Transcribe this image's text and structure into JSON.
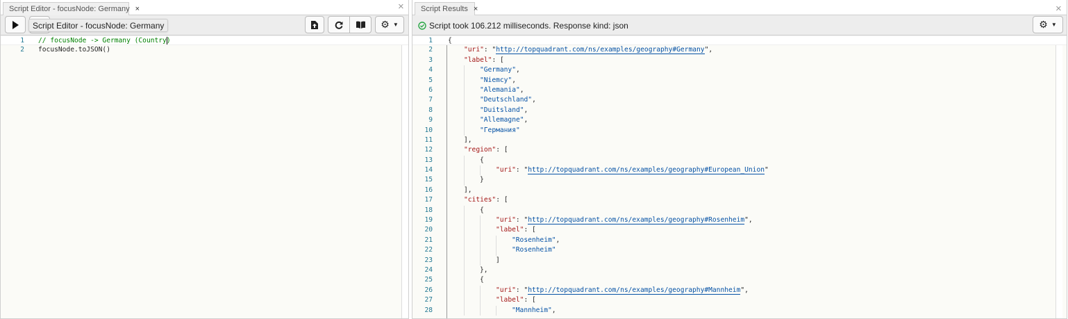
{
  "left": {
    "tab_label": "Script Editor - focusNode: Germany",
    "tab_close": "×",
    "panel_close": "×",
    "tooltip": "Script Editor - focusNode: Germany",
    "toolbar": {
      "run_icon": "play-icon",
      "export_icon": "file-export-icon",
      "refresh_icon": "refresh-icon",
      "docs_icon": "book-icon",
      "settings_icon": "gear-icon"
    },
    "lines": [
      {
        "n": "1",
        "parts": [
          {
            "t": "// focusNode -> Germany (Country)",
            "k": "c"
          }
        ]
      },
      {
        "n": "2",
        "parts": [
          {
            "t": "focusNode.toJSON()",
            "k": "p"
          }
        ]
      }
    ]
  },
  "right": {
    "tab_label": "Script Results",
    "tab_close": "×",
    "panel_close": "×",
    "status": "Script took 106.212 milliseconds. Response kind: json",
    "status_icon": "check-circle-icon",
    "colors": {
      "success": "#28a745",
      "key": "#a31515",
      "string": "#0451a5",
      "line_number": "#237893"
    },
    "lines": [
      {
        "n": "1",
        "i": 0,
        "parts": [
          {
            "t": "{",
            "k": "p"
          }
        ]
      },
      {
        "n": "2",
        "i": 1,
        "parts": [
          {
            "t": "\"uri\"",
            "k": "k"
          },
          {
            "t": ": \"",
            "k": "p"
          },
          {
            "t": "http://topquadrant.com/ns/examples/geography#Germany",
            "k": "link"
          },
          {
            "t": "\",",
            "k": "p"
          }
        ]
      },
      {
        "n": "3",
        "i": 1,
        "parts": [
          {
            "t": "\"label\"",
            "k": "k"
          },
          {
            "t": ": [",
            "k": "p"
          }
        ]
      },
      {
        "n": "4",
        "i": 2,
        "parts": [
          {
            "t": "\"Germany\"",
            "k": "s"
          },
          {
            "t": ",",
            "k": "p"
          }
        ]
      },
      {
        "n": "5",
        "i": 2,
        "parts": [
          {
            "t": "\"Niemcy\"",
            "k": "s"
          },
          {
            "t": ",",
            "k": "p"
          }
        ]
      },
      {
        "n": "6",
        "i": 2,
        "parts": [
          {
            "t": "\"Alemania\"",
            "k": "s"
          },
          {
            "t": ",",
            "k": "p"
          }
        ]
      },
      {
        "n": "7",
        "i": 2,
        "parts": [
          {
            "t": "\"Deutschland\"",
            "k": "s"
          },
          {
            "t": ",",
            "k": "p"
          }
        ]
      },
      {
        "n": "8",
        "i": 2,
        "parts": [
          {
            "t": "\"Duitsland\"",
            "k": "s"
          },
          {
            "t": ",",
            "k": "p"
          }
        ]
      },
      {
        "n": "9",
        "i": 2,
        "parts": [
          {
            "t": "\"Allemagne\"",
            "k": "s"
          },
          {
            "t": ",",
            "k": "p"
          }
        ]
      },
      {
        "n": "10",
        "i": 2,
        "parts": [
          {
            "t": "\"Германия\"",
            "k": "s"
          }
        ]
      },
      {
        "n": "11",
        "i": 1,
        "parts": [
          {
            "t": "],",
            "k": "p"
          }
        ]
      },
      {
        "n": "12",
        "i": 1,
        "parts": [
          {
            "t": "\"region\"",
            "k": "k"
          },
          {
            "t": ": [",
            "k": "p"
          }
        ]
      },
      {
        "n": "13",
        "i": 2,
        "parts": [
          {
            "t": "{",
            "k": "p"
          }
        ]
      },
      {
        "n": "14",
        "i": 3,
        "parts": [
          {
            "t": "\"uri\"",
            "k": "k"
          },
          {
            "t": ": \"",
            "k": "p"
          },
          {
            "t": "http://topquadrant.com/ns/examples/geography#European_Union",
            "k": "link"
          },
          {
            "t": "\"",
            "k": "p"
          }
        ]
      },
      {
        "n": "15",
        "i": 2,
        "parts": [
          {
            "t": "}",
            "k": "p"
          }
        ]
      },
      {
        "n": "16",
        "i": 1,
        "parts": [
          {
            "t": "],",
            "k": "p"
          }
        ]
      },
      {
        "n": "17",
        "i": 1,
        "parts": [
          {
            "t": "\"cities\"",
            "k": "k"
          },
          {
            "t": ": [",
            "k": "p"
          }
        ]
      },
      {
        "n": "18",
        "i": 2,
        "parts": [
          {
            "t": "{",
            "k": "p"
          }
        ]
      },
      {
        "n": "19",
        "i": 3,
        "parts": [
          {
            "t": "\"uri\"",
            "k": "k"
          },
          {
            "t": ": \"",
            "k": "p"
          },
          {
            "t": "http://topquadrant.com/ns/examples/geography#Rosenheim",
            "k": "link"
          },
          {
            "t": "\",",
            "k": "p"
          }
        ]
      },
      {
        "n": "20",
        "i": 3,
        "parts": [
          {
            "t": "\"label\"",
            "k": "k"
          },
          {
            "t": ": [",
            "k": "p"
          }
        ]
      },
      {
        "n": "21",
        "i": 4,
        "parts": [
          {
            "t": "\"Rosenheim\"",
            "k": "s"
          },
          {
            "t": ",",
            "k": "p"
          }
        ]
      },
      {
        "n": "22",
        "i": 4,
        "parts": [
          {
            "t": "\"Rosenheim\"",
            "k": "s"
          }
        ]
      },
      {
        "n": "23",
        "i": 3,
        "parts": [
          {
            "t": "]",
            "k": "p"
          }
        ]
      },
      {
        "n": "24",
        "i": 2,
        "parts": [
          {
            "t": "},",
            "k": "p"
          }
        ]
      },
      {
        "n": "25",
        "i": 2,
        "parts": [
          {
            "t": "{",
            "k": "p"
          }
        ]
      },
      {
        "n": "26",
        "i": 3,
        "parts": [
          {
            "t": "\"uri\"",
            "k": "k"
          },
          {
            "t": ": \"",
            "k": "p"
          },
          {
            "t": "http://topquadrant.com/ns/examples/geography#Mannheim",
            "k": "link"
          },
          {
            "t": "\",",
            "k": "p"
          }
        ]
      },
      {
        "n": "27",
        "i": 3,
        "parts": [
          {
            "t": "\"label\"",
            "k": "k"
          },
          {
            "t": ": [",
            "k": "p"
          }
        ]
      },
      {
        "n": "28",
        "i": 4,
        "parts": [
          {
            "t": "\"Mannheim\"",
            "k": "s"
          },
          {
            "t": ",",
            "k": "p"
          }
        ]
      }
    ]
  }
}
